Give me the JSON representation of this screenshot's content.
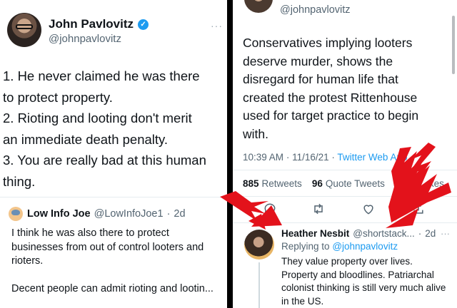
{
  "left": {
    "author_name": "John Pavlovitz",
    "author_handle": "@johnpavlovitz",
    "more_label": "···",
    "body_lines": [
      "1. He never claimed he was there",
      "to protect property.",
      "2. Rioting and looting don't merit",
      "an immediate death penalty.",
      "3. You are really bad at this human",
      "thing."
    ],
    "quote": {
      "name": "Low Info Joe",
      "handle": "@LowInfoJoe1",
      "dot": "·",
      "time": "2d",
      "lines": [
        "I think he was also there to protect",
        "businesses from out of control looters and",
        "rioters.",
        "",
        "Decent people can admit rioting and lootin..."
      ]
    }
  },
  "right": {
    "top_handle": "@johnpavlovitz",
    "body_lines": [
      "Conservatives implying looters",
      "deserve murder, shows the",
      "disregard for human life that",
      "created the protest Rittenhouse",
      "used for target practice to begin",
      "with."
    ],
    "meta": {
      "time": "10:39 AM",
      "dot": "·",
      "date": "11/16/21",
      "dot2": "·",
      "via": "Twitter Web App"
    },
    "stats": {
      "retweets_count": "885",
      "retweets_label": "Retweets",
      "quotes_count": "96",
      "quotes_label": "Quote Tweets",
      "likes_tail": "kes"
    },
    "actions": {
      "reply_icon": "reply-icon",
      "retweet_icon": "retweet-icon",
      "like_icon": "heart-icon",
      "share_icon": "share-icon"
    },
    "reply": {
      "name": "Heather Nesbit",
      "handle": "@shortstack...",
      "dot": "·",
      "time": "2d",
      "more": "···",
      "replying_prefix": "Replying to",
      "replying_to": "@johnpavlovitz",
      "lines": [
        "They value property over lives.",
        "Property and bloodlines. Patriarchal",
        "colonist thinking is still very much alive",
        "in the US."
      ]
    }
  },
  "colors": {
    "link_blue": "#1d9bf0",
    "arrow_red": "#e3121b",
    "muted": "#536471"
  }
}
